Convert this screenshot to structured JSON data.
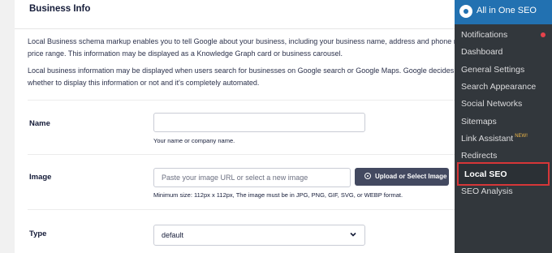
{
  "card": {
    "title": "Business Info",
    "desc_line1": "Local Business schema markup enables you to tell Google about your business, including your business name, address and phone number, opening hours and",
    "desc_line2": "price range. This information may be displayed as a Knowledge Graph card or business carousel.",
    "desc_line3": "Local business information may be displayed when users search for businesses on Google search or Google Maps. Google decides on a per-query basis",
    "desc_line4": "whether to display this information or not and it's completely automated."
  },
  "fields": {
    "name": {
      "label": "Name",
      "value": "",
      "hint": "Your name or company name."
    },
    "image": {
      "label": "Image",
      "placeholder": "Paste your image URL or select a new image",
      "button": "Upload or Select Image",
      "hint": "Minimum size: 112px x 112px, The image must be in JPG, PNG, GIF, SVG, or WEBP format."
    },
    "type": {
      "label": "Type",
      "selected": "default"
    }
  },
  "wpmenu": {
    "title": "All in One SEO",
    "items": [
      {
        "label": "Notifications"
      },
      {
        "label": "Dashboard"
      },
      {
        "label": "General Settings"
      },
      {
        "label": "Search Appearance"
      },
      {
        "label": "Social Networks"
      },
      {
        "label": "Sitemaps"
      },
      {
        "label": "Link Assistant",
        "badge": "NEW!"
      },
      {
        "label": "Redirects"
      },
      {
        "label": "Local SEO"
      },
      {
        "label": "SEO Analysis"
      }
    ]
  },
  "colors": {
    "accent": "#2271b1",
    "highlight_border": "#d63638",
    "notification_dot": "#e5424b",
    "button_bg": "#434960"
  },
  "icons": {
    "logo": "aioseo-logo-icon",
    "upload": "upload-icon",
    "select": "chevron-down-icon"
  }
}
